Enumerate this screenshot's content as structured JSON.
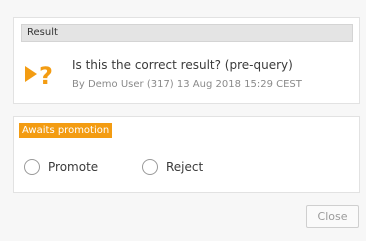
{
  "result_panel": {
    "header_label": "Result",
    "icon": "play-question-icon",
    "question": "Is this the correct result? (pre-query)",
    "meta": "By Demo User (317) 13 Aug 2018 15:29 CEST"
  },
  "promotion_panel": {
    "status_badge": "Awaits promotion",
    "options": [
      {
        "label": "Promote",
        "selected": false
      },
      {
        "label": "Reject",
        "selected": false
      }
    ]
  },
  "footer": {
    "close_label": "Close"
  },
  "colors": {
    "accent_orange": "#f39c12",
    "badge_text": "#ffffff"
  }
}
